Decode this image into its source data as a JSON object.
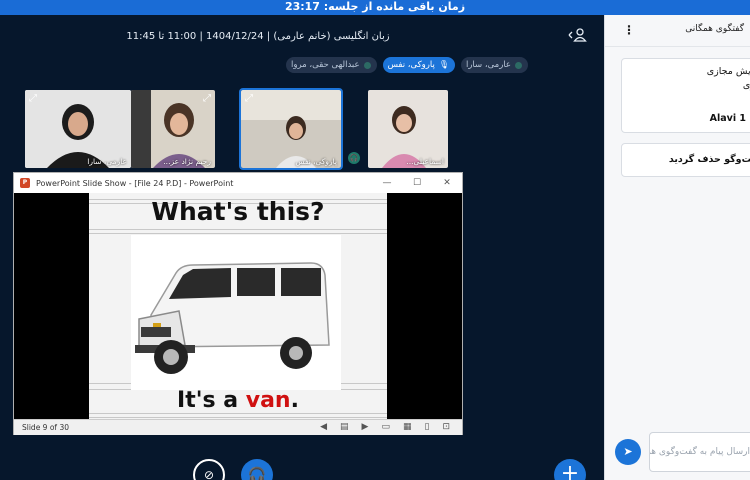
{
  "topbar": {
    "timer_text": "زمان باقی مانده از جلسه: 23:17"
  },
  "header": {
    "session_title": "زبان انگلیسی (خانم عارمی) | 1404/12/24 | 11:00 تا 11:45"
  },
  "participant_chips": [
    {
      "name": "عبدالهی حقی، مروا",
      "active": false
    },
    {
      "name": "پاروکی، نفس",
      "active": true
    },
    {
      "name": "عارمی، سارا",
      "active": false
    }
  ],
  "video_tiles": [
    {
      "name": "عارمی، سارا"
    },
    {
      "name": "رحیم نژاد عز..."
    },
    {
      "name": "پاروکی، نفس"
    },
    {
      "name": "اسماعیلی..."
    }
  ],
  "ppt": {
    "window_title": "PowerPoint Slide Show - [File 24 P.D] - PowerPoint",
    "logo_letter": "P",
    "controls": {
      "minimize": "—",
      "maximize": "☐",
      "close": "✕"
    },
    "slide_heading": "What's this?",
    "slide_answer_prefix": "It's a ",
    "slide_answer_word": "van",
    "slide_answer_suffix": ".",
    "status_text": "Slide 9 of 30"
  },
  "chat": {
    "title": "گفتگوی همگانی",
    "menu_glyph": "⋮",
    "messages": [
      {
        "lines": [
          "همایش مجازی",
          "علوی"
        ],
        "signature": "Alavi 1"
      },
      {
        "text": "گفت‌وگو حذف گردید"
      }
    ],
    "input_placeholder": "ارسال پیام به گفت‌وگوی همگانی"
  },
  "icons": {
    "user": "user-icon",
    "expand": "expand-icon",
    "mic": "mic-icon",
    "video_off": "video-off-icon",
    "headphones": "headphones-icon",
    "plus": "plus-icon",
    "send": "send-icon"
  },
  "colors": {
    "accent": "#1c74d8",
    "background": "#06172c",
    "answer_red": "#d01010"
  }
}
